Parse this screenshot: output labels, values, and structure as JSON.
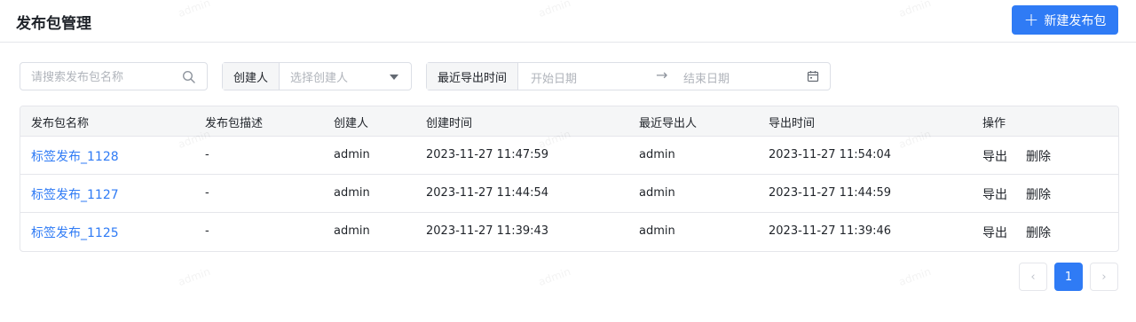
{
  "header": {
    "title": "发布包管理",
    "new_button_label": "新建发布包"
  },
  "filters": {
    "search_placeholder": "请搜索发布包名称",
    "creator_label": "创建人",
    "creator_placeholder": "选择创建人",
    "export_time_label": "最近导出时间",
    "start_date_placeholder": "开始日期",
    "end_date_placeholder": "结束日期",
    "range_separator": "→"
  },
  "table": {
    "columns": [
      "发布包名称",
      "发布包描述",
      "创建人",
      "创建时间",
      "最近导出人",
      "导出时间",
      "操作"
    ],
    "rows": [
      {
        "name": "标签发布_1128",
        "desc": "-",
        "creator": "admin",
        "created": "2023-11-27 11:47:59",
        "exporter": "admin",
        "exported": "2023-11-27 11:54:04",
        "action_export": "导出",
        "action_delete": "删除"
      },
      {
        "name": "标签发布_1127",
        "desc": "-",
        "creator": "admin",
        "created": "2023-11-27 11:44:54",
        "exporter": "admin",
        "exported": "2023-11-27 11:44:59",
        "action_export": "导出",
        "action_delete": "删除"
      },
      {
        "name": "标签发布_1125",
        "desc": "-",
        "creator": "admin",
        "created": "2023-11-27 11:39:43",
        "exporter": "admin",
        "exported": "2023-11-27 11:39:46",
        "action_export": "导出",
        "action_delete": "删除"
      }
    ]
  },
  "pagination": {
    "prev": "‹",
    "current_page": "1",
    "next": "›"
  },
  "watermark": "admin",
  "colors": {
    "accent": "#2f7bf5"
  }
}
